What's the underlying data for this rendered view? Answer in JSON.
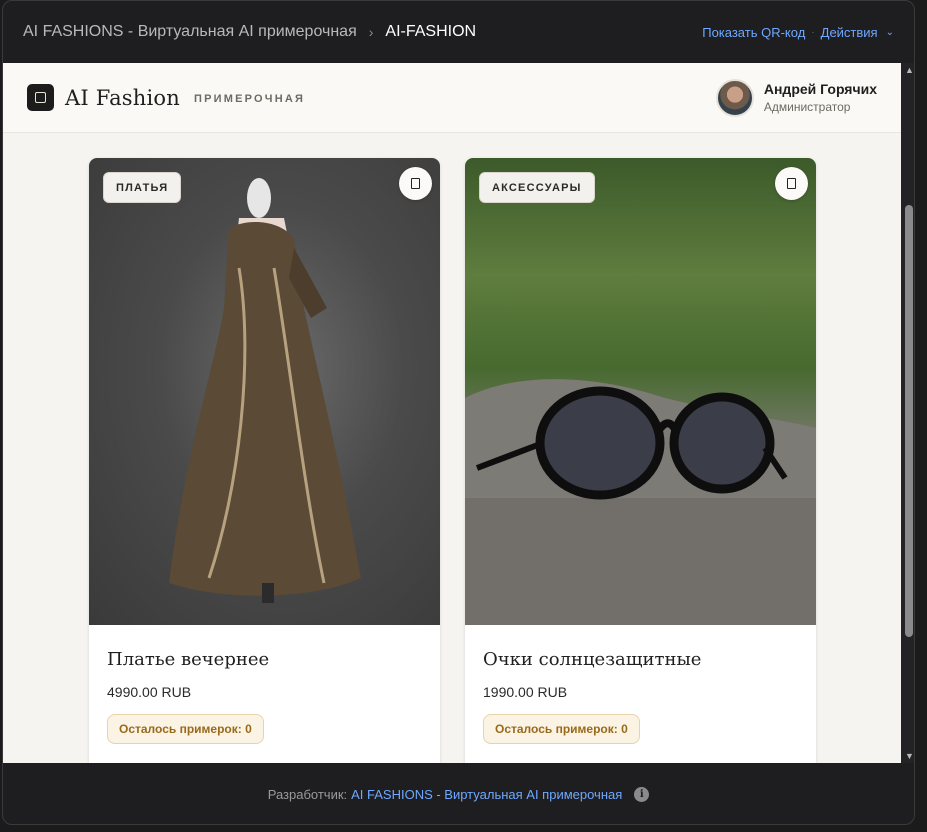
{
  "topbar": {
    "app_name": "AI FASHIONS - Виртуальная AI примерочная",
    "separator": "›",
    "current": "AI-FASHION",
    "qr_link": "Показать QR-код",
    "dot": "·",
    "actions_label": "Действия",
    "actions_chevron": "⌄"
  },
  "header": {
    "brand": "AI Fashion",
    "brand_sub": "ПРИМЕРОЧНАЯ",
    "user": {
      "name": "Андрей Горячих",
      "role": "Администратор"
    }
  },
  "products": [
    {
      "category": "ПЛАТЬЯ",
      "title": "Платье вечернее",
      "price": "4990.00 RUB",
      "tries": "Осталось примерок: 0"
    },
    {
      "category": "АКСЕССУАРЫ",
      "title": "Очки солнцезащитные",
      "price": "1990.00 RUB",
      "tries": "Осталось примерок: 0"
    }
  ],
  "scroll": {
    "up": "▲",
    "down": "▼"
  },
  "footer": {
    "prefix": "Разработчик:",
    "link": "AI FASHIONS - Виртуальная AI примерочная",
    "info": "i"
  }
}
